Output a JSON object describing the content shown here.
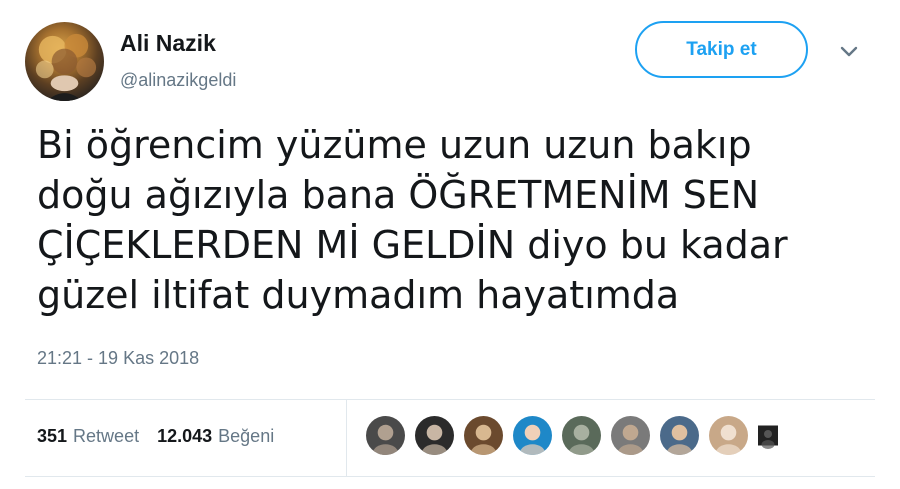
{
  "author": {
    "name": "Ali Nazik",
    "handle": "@alinazikgeldi",
    "avatar_icon": "profile-avatar"
  },
  "follow_button": {
    "label": "Takip et",
    "color": "#1da1f2"
  },
  "menu_icon": "chevron-down-icon",
  "tweet": {
    "text": "Bi öğrencim yüzüme uzun uzun bakıp\ndoğu ağızıyla bana ÖĞRETMENİM SEN\nÇİÇEKLERDEN Mİ GELDİN diyo bu kadar\ngüzel iltifat duymadım hayatımda",
    "timestamp": "21:21 - 19 Kas 2018"
  },
  "stats": {
    "retweets_count": "351",
    "retweets_label": "Retweet",
    "likes_count": "12.043",
    "likes_label": "Beğeni"
  },
  "likers": [
    {
      "color": "#4a4a4a",
      "accent": "#b0a090"
    },
    {
      "color": "#2b2b2b",
      "accent": "#c8b6a4"
    },
    {
      "color": "#6b4a2e",
      "accent": "#d8b890"
    },
    {
      "color": "#1e88c8",
      "accent": "#f0d0b8"
    },
    {
      "color": "#5a6a5a",
      "accent": "#a8b0a0"
    },
    {
      "color": "#7a7a7a",
      "accent": "#c0a890"
    },
    {
      "color": "#4b6a8a",
      "accent": "#e0c0a0"
    },
    {
      "color": "#c8a888",
      "accent": "#f0e0d0"
    },
    {
      "color": "#222222",
      "accent": "#555555"
    }
  ]
}
